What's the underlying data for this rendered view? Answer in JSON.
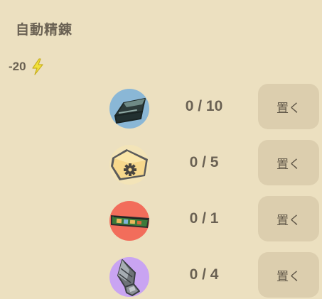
{
  "panel": {
    "title": "自動精錬",
    "energy_cost": "-20",
    "energy_icon": "lightning-bolt-icon"
  },
  "items": [
    {
      "icon": "iron-ingot-icon",
      "icon_bg": "#8ab7d6",
      "count": "0 / 10",
      "button": "置く"
    },
    {
      "icon": "gear-package-icon",
      "icon_bg": "#f3e4b8",
      "count": "0 / 5",
      "button": "置く"
    },
    {
      "icon": "circuit-board-icon",
      "icon_bg": "#f26d5b",
      "count": "0 / 1",
      "button": "置く"
    },
    {
      "icon": "drill-bit-icon",
      "icon_bg": "#c9a4f2",
      "count": "0 / 4",
      "button": "置く"
    }
  ]
}
